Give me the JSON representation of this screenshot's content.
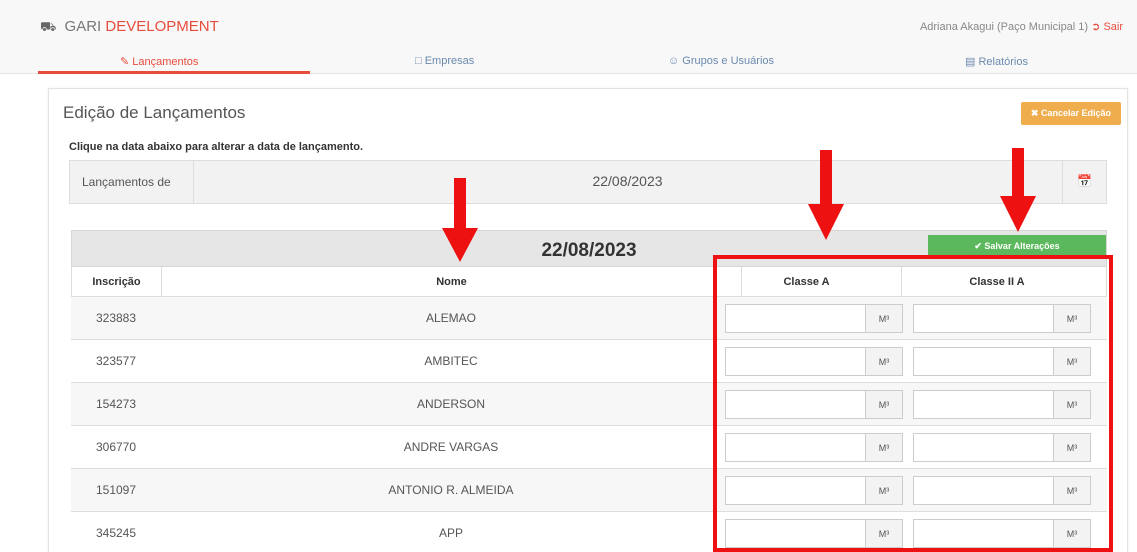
{
  "header": {
    "brand_part1": "GARI",
    "brand_part2": "DEVELOPMENT",
    "user": "Adriana Akagui (Paço Municipal 1)",
    "logout": "Sair"
  },
  "nav": {
    "tabs": [
      {
        "label": "Lançamentos",
        "active": true
      },
      {
        "label": "Empresas",
        "active": false
      },
      {
        "label": "Grupos e Usuários",
        "active": false
      },
      {
        "label": "Relatórios",
        "active": false
      }
    ]
  },
  "panel": {
    "title": "Edição de Lançamentos",
    "cancel_button": "Cancelar Edição",
    "hint": "Clique na data abaixo para alterar a data de lançamento.",
    "date_label": "Lançamentos de",
    "date_value": "22/08/2023"
  },
  "table": {
    "date_header": "22/08/2023",
    "save_button": "Salvar Alterações",
    "columns": [
      "Inscrição",
      "Nome",
      "Classe A",
      "Classe II A"
    ],
    "unit": "M³",
    "rows": [
      {
        "inscricao": "323883",
        "nome": "ALEMAO"
      },
      {
        "inscricao": "323577",
        "nome": "AMBITEC"
      },
      {
        "inscricao": "154273",
        "nome": "ANDERSON"
      },
      {
        "inscricao": "306770",
        "nome": "ANDRE VARGAS"
      },
      {
        "inscricao": "151097",
        "nome": "ANTONIO R. ALMEIDA"
      },
      {
        "inscricao": "345245",
        "nome": "APP"
      }
    ]
  },
  "colors": {
    "accent": "#e74c3c",
    "annotation": "#ee1111",
    "save": "#5cb85c",
    "cancel": "#f0ad4e"
  }
}
